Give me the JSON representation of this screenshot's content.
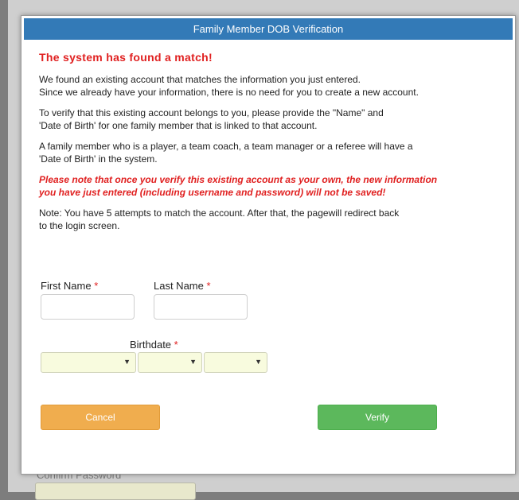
{
  "background": {
    "confirm_password_label": "Confirm Password"
  },
  "modal": {
    "title": "Family Member DOB Verification",
    "match_title": "The system has found a match!",
    "para1_line1": "We found an existing account that matches the information you just entered.",
    "para1_line2": "Since we already have your information, there is no need for you to create a new account.",
    "para2_line1": "To verify that this existing account belongs to you, please provide the \"Name\" and",
    "para2_line2": "'Date of Birth' for one family member that is linked to that account.",
    "para3_line1": "A family member who is a player, a team coach, a team manager or a referee will have a",
    "para3_line2": "'Date of Birth' in the system.",
    "warning_line1": "Please note that once you verify this existing account as your own, the new information",
    "warning_line2": "you have just entered (including username and password) will not be saved!",
    "note_line1": "Note: You have 5 attempts to match the account. After that, the pagewill redirect back",
    "note_line2": "to the login screen.",
    "first_name_label": "First Name",
    "last_name_label": "Last Name",
    "birthdate_label": "Birthdate",
    "required_mark": "*",
    "first_name_value": "",
    "last_name_value": "",
    "cancel_label": "Cancel",
    "verify_label": "Verify",
    "dropdown_arrow": "▼"
  },
  "colors": {
    "header_bg": "#337ab7",
    "error_red": "#e02020",
    "cancel": "#f0ad4e",
    "verify": "#5cb85c"
  }
}
